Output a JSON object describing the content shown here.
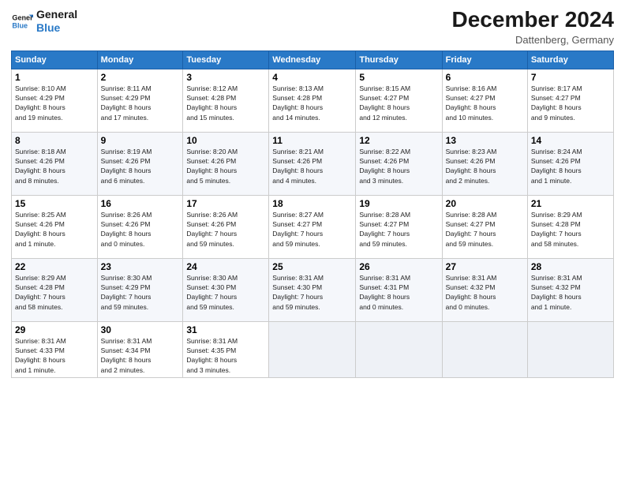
{
  "header": {
    "logo_line1": "General",
    "logo_line2": "Blue",
    "title": "December 2024",
    "subtitle": "Dattenberg, Germany"
  },
  "days_of_week": [
    "Sunday",
    "Monday",
    "Tuesday",
    "Wednesday",
    "Thursday",
    "Friday",
    "Saturday"
  ],
  "weeks": [
    [
      {
        "day": 1,
        "info": "Sunrise: 8:10 AM\nSunset: 4:29 PM\nDaylight: 8 hours\nand 19 minutes."
      },
      {
        "day": 2,
        "info": "Sunrise: 8:11 AM\nSunset: 4:29 PM\nDaylight: 8 hours\nand 17 minutes."
      },
      {
        "day": 3,
        "info": "Sunrise: 8:12 AM\nSunset: 4:28 PM\nDaylight: 8 hours\nand 15 minutes."
      },
      {
        "day": 4,
        "info": "Sunrise: 8:13 AM\nSunset: 4:28 PM\nDaylight: 8 hours\nand 14 minutes."
      },
      {
        "day": 5,
        "info": "Sunrise: 8:15 AM\nSunset: 4:27 PM\nDaylight: 8 hours\nand 12 minutes."
      },
      {
        "day": 6,
        "info": "Sunrise: 8:16 AM\nSunset: 4:27 PM\nDaylight: 8 hours\nand 10 minutes."
      },
      {
        "day": 7,
        "info": "Sunrise: 8:17 AM\nSunset: 4:27 PM\nDaylight: 8 hours\nand 9 minutes."
      }
    ],
    [
      {
        "day": 8,
        "info": "Sunrise: 8:18 AM\nSunset: 4:26 PM\nDaylight: 8 hours\nand 8 minutes."
      },
      {
        "day": 9,
        "info": "Sunrise: 8:19 AM\nSunset: 4:26 PM\nDaylight: 8 hours\nand 6 minutes."
      },
      {
        "day": 10,
        "info": "Sunrise: 8:20 AM\nSunset: 4:26 PM\nDaylight: 8 hours\nand 5 minutes."
      },
      {
        "day": 11,
        "info": "Sunrise: 8:21 AM\nSunset: 4:26 PM\nDaylight: 8 hours\nand 4 minutes."
      },
      {
        "day": 12,
        "info": "Sunrise: 8:22 AM\nSunset: 4:26 PM\nDaylight: 8 hours\nand 3 minutes."
      },
      {
        "day": 13,
        "info": "Sunrise: 8:23 AM\nSunset: 4:26 PM\nDaylight: 8 hours\nand 2 minutes."
      },
      {
        "day": 14,
        "info": "Sunrise: 8:24 AM\nSunset: 4:26 PM\nDaylight: 8 hours\nand 1 minute."
      }
    ],
    [
      {
        "day": 15,
        "info": "Sunrise: 8:25 AM\nSunset: 4:26 PM\nDaylight: 8 hours\nand 1 minute."
      },
      {
        "day": 16,
        "info": "Sunrise: 8:26 AM\nSunset: 4:26 PM\nDaylight: 8 hours\nand 0 minutes."
      },
      {
        "day": 17,
        "info": "Sunrise: 8:26 AM\nSunset: 4:26 PM\nDaylight: 7 hours\nand 59 minutes."
      },
      {
        "day": 18,
        "info": "Sunrise: 8:27 AM\nSunset: 4:27 PM\nDaylight: 7 hours\nand 59 minutes."
      },
      {
        "day": 19,
        "info": "Sunrise: 8:28 AM\nSunset: 4:27 PM\nDaylight: 7 hours\nand 59 minutes."
      },
      {
        "day": 20,
        "info": "Sunrise: 8:28 AM\nSunset: 4:27 PM\nDaylight: 7 hours\nand 59 minutes."
      },
      {
        "day": 21,
        "info": "Sunrise: 8:29 AM\nSunset: 4:28 PM\nDaylight: 7 hours\nand 58 minutes."
      }
    ],
    [
      {
        "day": 22,
        "info": "Sunrise: 8:29 AM\nSunset: 4:28 PM\nDaylight: 7 hours\nand 58 minutes."
      },
      {
        "day": 23,
        "info": "Sunrise: 8:30 AM\nSunset: 4:29 PM\nDaylight: 7 hours\nand 59 minutes."
      },
      {
        "day": 24,
        "info": "Sunrise: 8:30 AM\nSunset: 4:30 PM\nDaylight: 7 hours\nand 59 minutes."
      },
      {
        "day": 25,
        "info": "Sunrise: 8:31 AM\nSunset: 4:30 PM\nDaylight: 7 hours\nand 59 minutes."
      },
      {
        "day": 26,
        "info": "Sunrise: 8:31 AM\nSunset: 4:31 PM\nDaylight: 8 hours\nand 0 minutes."
      },
      {
        "day": 27,
        "info": "Sunrise: 8:31 AM\nSunset: 4:32 PM\nDaylight: 8 hours\nand 0 minutes."
      },
      {
        "day": 28,
        "info": "Sunrise: 8:31 AM\nSunset: 4:32 PM\nDaylight: 8 hours\nand 1 minute."
      }
    ],
    [
      {
        "day": 29,
        "info": "Sunrise: 8:31 AM\nSunset: 4:33 PM\nDaylight: 8 hours\nand 1 minute."
      },
      {
        "day": 30,
        "info": "Sunrise: 8:31 AM\nSunset: 4:34 PM\nDaylight: 8 hours\nand 2 minutes."
      },
      {
        "day": 31,
        "info": "Sunrise: 8:31 AM\nSunset: 4:35 PM\nDaylight: 8 hours\nand 3 minutes."
      },
      null,
      null,
      null,
      null
    ]
  ]
}
